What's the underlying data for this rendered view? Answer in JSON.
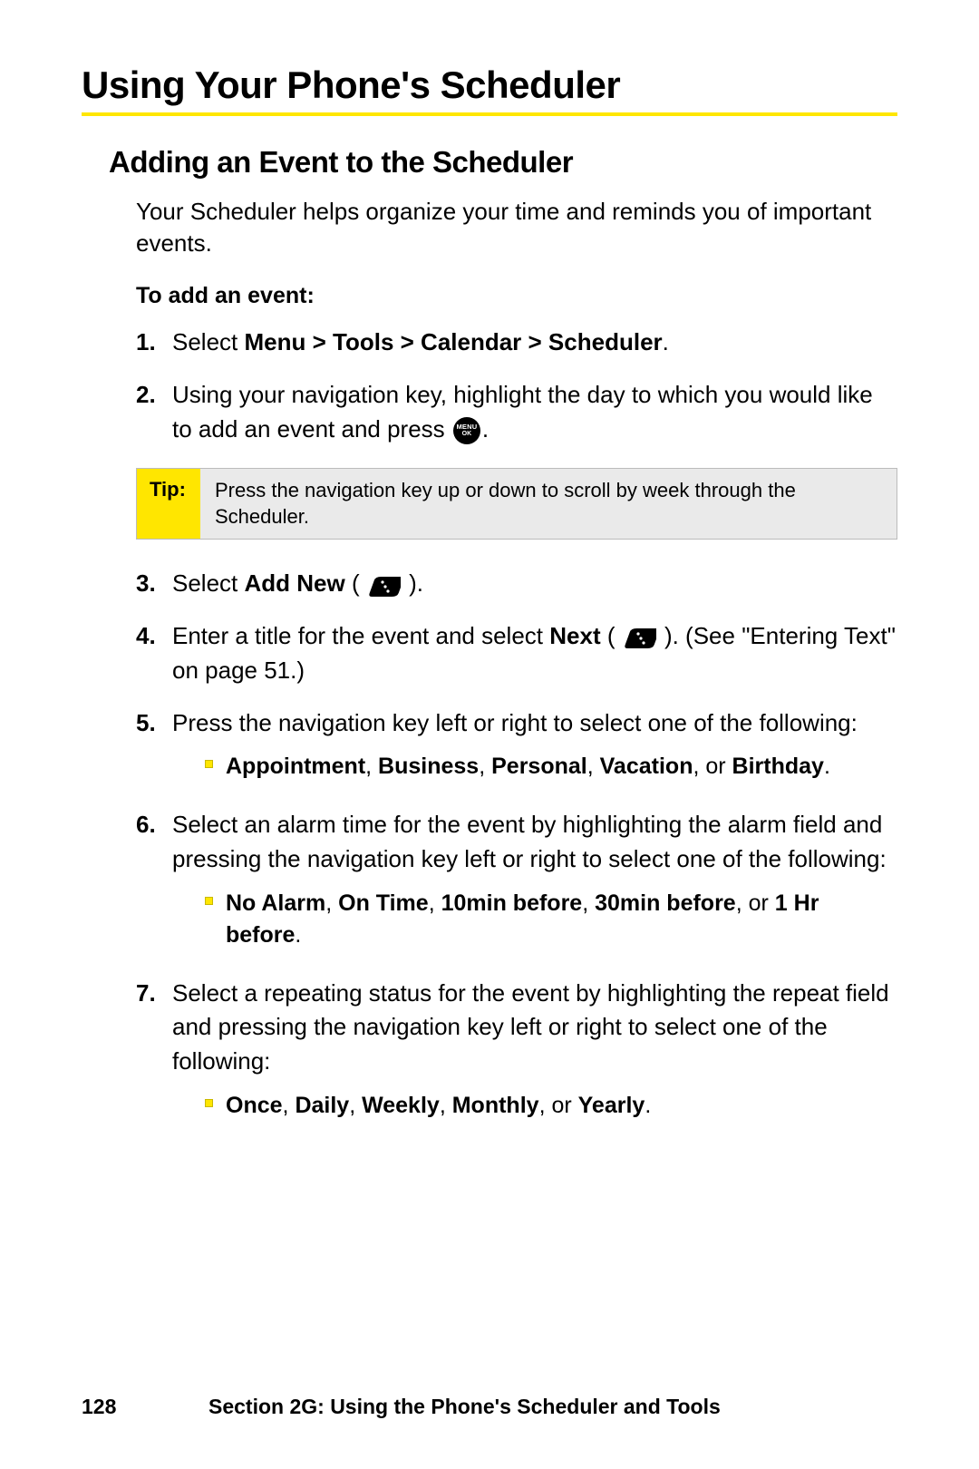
{
  "title": "Using Your Phone's Scheduler",
  "subtitle": "Adding an Event to the Scheduler",
  "intro": "Your Scheduler helps organize your time and reminds you of important events.",
  "leadin": "To add an event:",
  "steps": {
    "s1_num": "1.",
    "s1_a": "Select ",
    "s1_b": "Menu > Tools > Calendar > Scheduler",
    "s1_c": ".",
    "s2_num": "2.",
    "s2_a": "Using your navigation key, highlight the day to which you would like to add an event and press ",
    "s2_b": ".",
    "s3_num": "3.",
    "s3_a": "Select ",
    "s3_b": "Add New",
    "s3_c": " ( ",
    "s3_d": " ).",
    "s4_num": "4.",
    "s4_a": "Enter a title for the event and select ",
    "s4_b": "Next",
    "s4_c": " ( ",
    "s4_d": " ). (See \"Entering Text\" on page 51.)",
    "s5_num": "5.",
    "s5_a": "Press the navigation key left or right to select one of the following:",
    "s5_bullet_a": "Appointment",
    "s5_bullet_b": ", ",
    "s5_bullet_c": "Business",
    "s5_bullet_d": ", ",
    "s5_bullet_e": "Personal",
    "s5_bullet_f": ", ",
    "s5_bullet_g": "Vacation",
    "s5_bullet_h": ", or ",
    "s5_bullet_i": "Birthday",
    "s5_bullet_j": ".",
    "s6_num": "6.",
    "s6_a": "Select an alarm time for the event by highlighting the alarm field and pressing the navigation key left or right to select one of the following:",
    "s6_bullet_a": "No Alarm",
    "s6_bullet_b": ", ",
    "s6_bullet_c": "On Time",
    "s6_bullet_d": ", ",
    "s6_bullet_e": "10min before",
    "s6_bullet_f": ", ",
    "s6_bullet_g": "30min before",
    "s6_bullet_h": ", or ",
    "s6_bullet_i": "1 Hr before",
    "s6_bullet_j": ".",
    "s7_num": "7.",
    "s7_a": "Select a repeating status for the event by highlighting the repeat field and pressing the navigation key left or right to select one of the following:",
    "s7_bullet_a": "Once",
    "s7_bullet_b": ", ",
    "s7_bullet_c": "Daily",
    "s7_bullet_d": ", ",
    "s7_bullet_e": "Weekly",
    "s7_bullet_f": ", ",
    "s7_bullet_g": "Monthly",
    "s7_bullet_h": ", or ",
    "s7_bullet_i": "Yearly",
    "s7_bullet_j": "."
  },
  "tip": {
    "label": "Tip:",
    "body": "Press the navigation key up or down to scroll by week through the Scheduler."
  },
  "icons": {
    "menu": "MENU",
    "ok": "OK"
  },
  "footer": {
    "page": "128",
    "section": "Section 2G: Using the Phone's Scheduler and Tools"
  }
}
